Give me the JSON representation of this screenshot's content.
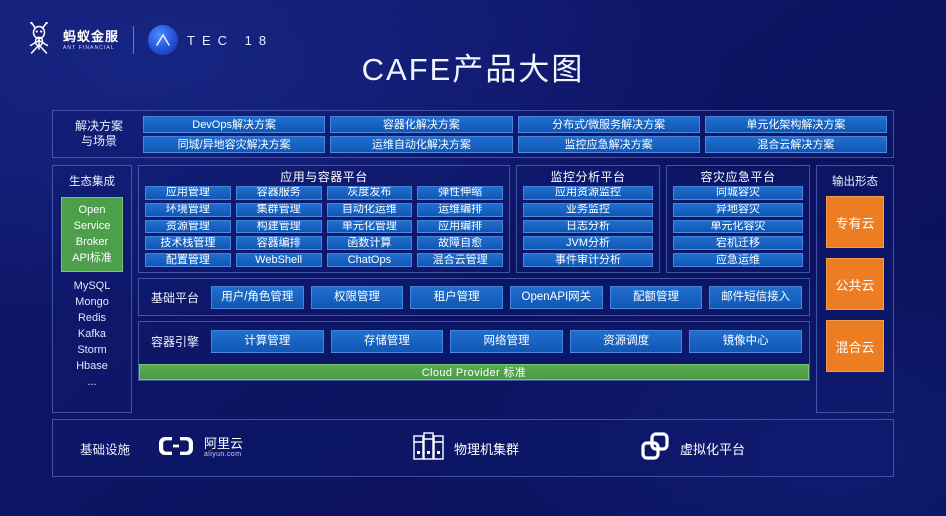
{
  "header": {
    "brand_cn": "蚂蚁金服",
    "brand_en": "ANT FINANCIAL",
    "event_logo_letter": "A",
    "event_text": "TEC 18",
    "title": "CAFE产品大图"
  },
  "solutions": {
    "label_line1": "解决方案",
    "label_line2": "与场景",
    "row1": [
      "DevOps解决方案",
      "容器化解决方案",
      "分布式/微服务解决方案",
      "单元化架构解决方案"
    ],
    "row2": [
      "同城/异地容灾解决方案",
      "运维自动化解决方案",
      "监控应急解决方案",
      "混合云解决方案"
    ]
  },
  "ecosystem": {
    "title": "生态集成",
    "standard": [
      "Open",
      "Service",
      "Broker",
      "API标准"
    ],
    "items": [
      "MySQL",
      "Mongo",
      "Redis",
      "Kafka",
      "Storm",
      "Hbase",
      "..."
    ]
  },
  "platforms": {
    "app_container": {
      "title": "应用与容器平台",
      "columns": [
        [
          "应用管理",
          "环境管理",
          "资源管理",
          "技术栈管理",
          "配置管理"
        ],
        [
          "容器服务",
          "集群管理",
          "构建管理",
          "容器编排",
          "WebShell"
        ],
        [
          "灰度发布",
          "自动化运维",
          "单元化管理",
          "函数计算",
          "ChatOps"
        ],
        [
          "弹性伸缩",
          "运维编排",
          "应用编排",
          "故障自愈",
          "混合云管理"
        ]
      ]
    },
    "monitor": {
      "title": "监控分析平台",
      "columns": [
        [
          "应用资源监控",
          "业务监控",
          "日志分析",
          "JVM分析",
          "事件审计分析"
        ]
      ]
    },
    "disaster_recovery": {
      "title": "容灾应急平台",
      "columns": [
        [
          "同城容灾",
          "异地容灾",
          "单元化容灾",
          "宕机迁移",
          "应急运维"
        ]
      ]
    }
  },
  "base_platform": {
    "label": "基础平台",
    "items": [
      "用户/角色管理",
      "权限管理",
      "租户管理",
      "OpenAPI网关",
      "配额管理",
      "邮件短信接入"
    ]
  },
  "container_engine": {
    "label": "容器引擎",
    "items": [
      "计算管理",
      "存储管理",
      "网络管理",
      "资源调度",
      "镜像中心"
    ],
    "cloud_provider": "Cloud Provider 标准"
  },
  "output": {
    "title": "输出形态",
    "items": [
      "专有云",
      "公共云",
      "混合云"
    ]
  },
  "infrastructure": {
    "label": "基础设施",
    "items": [
      {
        "icon": "aliyun-icon",
        "name": "阿里云",
        "sub": "aliyun.com"
      },
      {
        "icon": "server-rack-icon",
        "name": "物理机集群",
        "sub": ""
      },
      {
        "icon": "virtualization-icon",
        "name": "虚拟化平台",
        "sub": ""
      }
    ]
  },
  "colors": {
    "background": "#0d1464",
    "pill_blue": "#1560c0",
    "green": "#4e9f4a",
    "orange": "#ec7d22",
    "panel_border": "#7896e6"
  }
}
